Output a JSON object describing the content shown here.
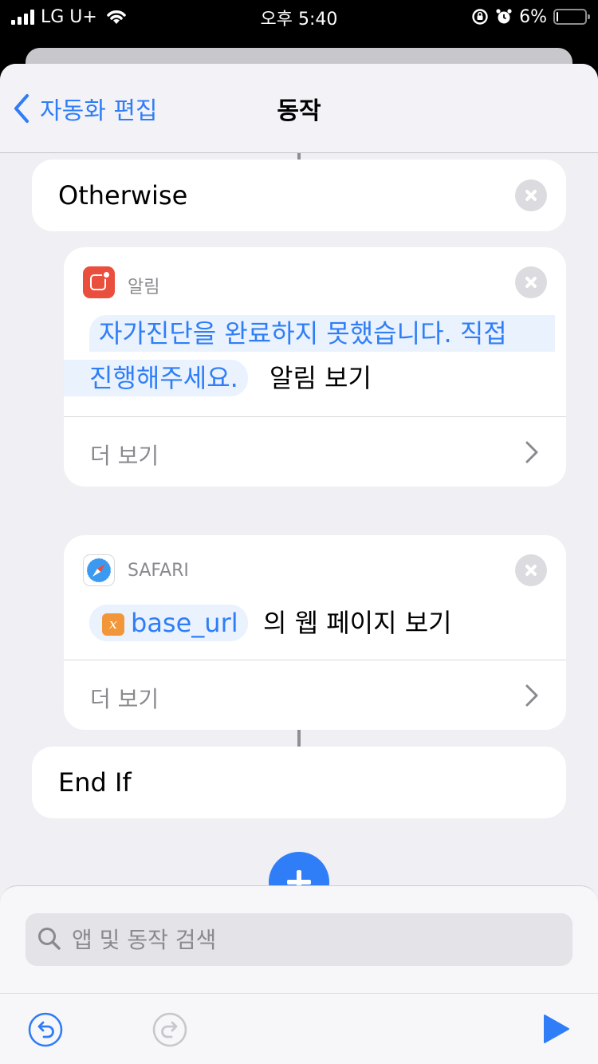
{
  "status_bar": {
    "carrier": "LG U+",
    "time": "오후 5:40",
    "battery": "6%",
    "battery_level": 0.06
  },
  "nav": {
    "back_label": "자동화 편집",
    "title": "동작"
  },
  "otherwise_block": {
    "title": "Otherwise"
  },
  "notification_action": {
    "app_label": "알림",
    "message_line1": "자가진단을 완료하지 못했습니다. 직접",
    "message_line2": "진행해주세요.",
    "action_text": "알림 보기",
    "more_label": "더 보기"
  },
  "safari_action": {
    "app_label": "SAFARI",
    "variable_icon": "x",
    "variable": "base_url",
    "action_text": "의 웹 페이지 보기",
    "more_label": "더 보기"
  },
  "end_if_block": {
    "title": "End If"
  },
  "search": {
    "placeholder": "앱 및 동작 검색"
  },
  "colors": {
    "accent": "#2f7ef7",
    "notification_icon": "#ea4e3d",
    "variable_icon": "#f2963a"
  },
  "icons": [
    "chevron-left-icon",
    "close-icon",
    "chevron-right-icon",
    "search-icon",
    "undo-icon",
    "redo-icon",
    "play-icon",
    "plus-icon"
  ]
}
